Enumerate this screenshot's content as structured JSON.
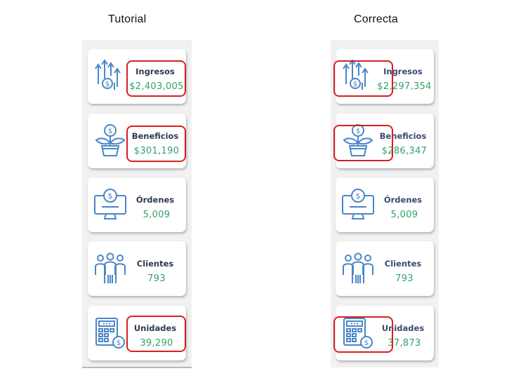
{
  "titles": {
    "left": "Tutorial",
    "right": "Correcta"
  },
  "colors": {
    "icon": "#4a86c8",
    "value": "#2fa36b",
    "label": "#2e3a4f",
    "highlight": "#d42020",
    "panel": "#f1f1f1"
  },
  "tutorial": {
    "cards": [
      {
        "icon": "revenue-arrows-icon",
        "label": "Ingresos",
        "value": "$2,403,005"
      },
      {
        "icon": "money-plant-icon",
        "label": "Beneficios",
        "value": "$301,190"
      },
      {
        "icon": "monitor-dollar-icon",
        "label": "Órdenes",
        "value": "5,009"
      },
      {
        "icon": "people-group-icon",
        "label": "Clientes",
        "value": "793"
      },
      {
        "icon": "calculator-dollar-icon",
        "label": "Unidades",
        "value": "39,290"
      }
    ]
  },
  "correcta": {
    "cards": [
      {
        "icon": "revenue-arrows-icon",
        "label": "Ingresos",
        "value": "$2,297,354"
      },
      {
        "icon": "money-plant-icon",
        "label": "Beneficios",
        "value": "$286,347"
      },
      {
        "icon": "monitor-dollar-icon",
        "label": "Órdenes",
        "value": "5,009"
      },
      {
        "icon": "people-group-icon",
        "label": "Clientes",
        "value": "793"
      },
      {
        "icon": "calculator-dollar-icon",
        "label": "Unidades",
        "value": "37,873"
      }
    ]
  }
}
